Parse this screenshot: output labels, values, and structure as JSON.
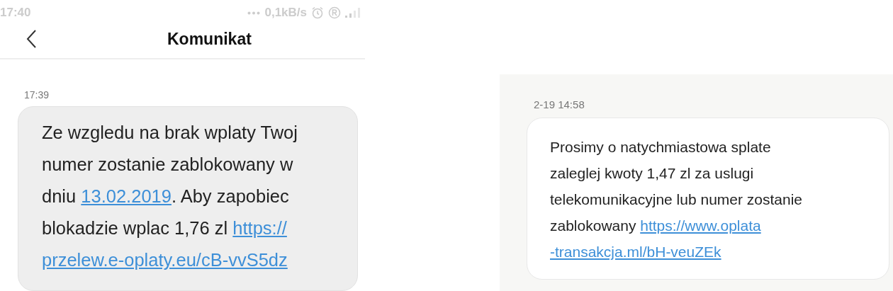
{
  "left_screen": {
    "status_bar": {
      "time": "17:40",
      "speed": "0,1kB/s"
    },
    "header": {
      "title": "Komunikat"
    },
    "message": {
      "time": "17:39",
      "lines": [
        [
          {
            "kind": "text",
            "text": "Ze wzgledu na brak wplaty Twoj"
          }
        ],
        [
          {
            "kind": "text",
            "text": "numer zostanie zablokowany w"
          }
        ],
        [
          {
            "kind": "text",
            "text": "dniu "
          },
          {
            "kind": "link",
            "text": "13.02.2019"
          },
          {
            "kind": "text",
            "text": ". Aby zapobiec"
          }
        ],
        [
          {
            "kind": "text",
            "text": "blokadzie wplac 1,76 zl "
          },
          {
            "kind": "link",
            "text": "https://"
          }
        ],
        [
          {
            "kind": "link",
            "text": "przelew.e-oplaty.eu/cB-vvS5dz"
          }
        ]
      ]
    }
  },
  "right_screen": {
    "message": {
      "time": "2-19 14:58",
      "lines": [
        [
          {
            "kind": "text",
            "text": "Prosimy o natychmiastowa splate"
          }
        ],
        [
          {
            "kind": "text",
            "text": "zaleglej kwoty 1,47 zl za uslugi"
          }
        ],
        [
          {
            "kind": "text",
            "text": "telekomunikacyjne lub numer zostanie"
          }
        ],
        [
          {
            "kind": "text",
            "text": "zablokowany "
          },
          {
            "kind": "link",
            "text": "https://www.oplata"
          }
        ],
        [
          {
            "kind": "link",
            "text": "-transakcja.ml/bH-veuZEk"
          }
        ]
      ]
    }
  }
}
